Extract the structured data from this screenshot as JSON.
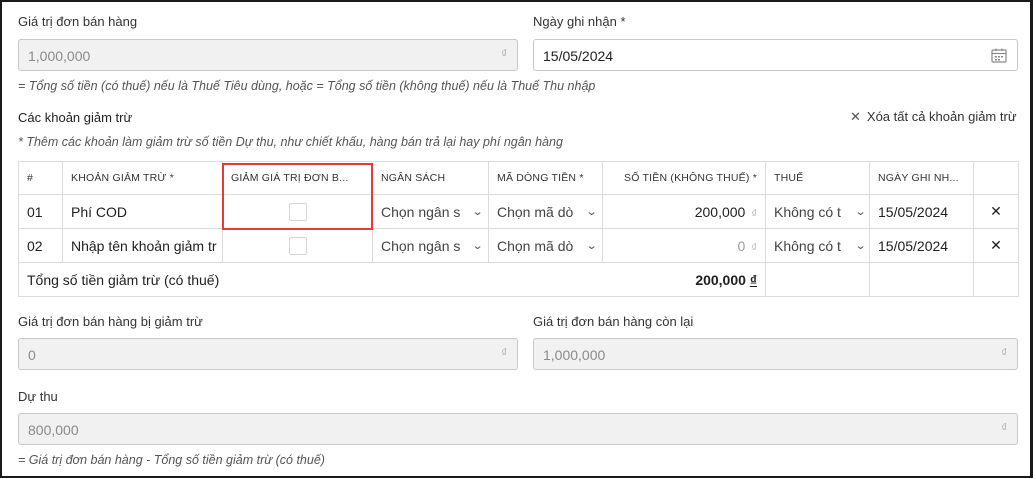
{
  "top": {
    "order_value_label": "Giá trị đơn bán hàng",
    "order_value": "1,000,000",
    "currency_symbol": "₫",
    "record_date_label": "Ngày ghi nhận *",
    "record_date": "15/05/2024",
    "note": "= Tổng số tiền (có thuế) nếu là Thuế Tiêu dùng, hoặc = Tổng số tiền (không thuế) nếu là Thuế Thu nhập"
  },
  "deductions": {
    "title": "Các khoản giảm trừ",
    "clear_all_icon": "close-icon",
    "clear_all": "Xóa tất cả khoản giảm trừ",
    "hint": "* Thêm các khoản làm giảm trừ số tiền Dự thu, như chiết khấu, hàng bán trả lại hay phí ngân hàng",
    "columns": [
      "#",
      "KHOẢN GIẢM TRỪ *",
      "GIẢM GIÁ TRỊ ĐƠN B...",
      "NGÂN SÁCH",
      "MÃ DÒNG TIỀN *",
      "SỐ TIỀN (KHÔNG THUẾ) *",
      "THUẾ",
      "NGÀY GHI NH..."
    ],
    "rows": [
      {
        "index": "01",
        "name": "Phí COD",
        "budget": "Chọn ngân s",
        "cashflow": "Chọn mã dò",
        "amount": "200,000",
        "currency": "₫",
        "tax": "Không có t",
        "date": "15/05/2024"
      },
      {
        "index": "02",
        "name_placeholder": "Nhập tên khoản giảm tr",
        "budget": "Chọn ngân s",
        "cashflow": "Chọn mã dò",
        "amount": "0",
        "currency": "₫",
        "tax": "Không có t",
        "date": "15/05/2024"
      }
    ],
    "total_label": "Tổng số tiền giảm trừ (có thuế)",
    "total_value": "200,000",
    "total_currency": "₫"
  },
  "bottom": {
    "reduced_label": "Giá trị đơn bán hàng bị giảm trừ",
    "reduced_value": "0",
    "remaining_label": "Giá trị đơn bán hàng còn lại",
    "remaining_value": "1,000,000",
    "expected_label": "Dự thu",
    "expected_value": "800,000",
    "expected_note": "= Giá trị đơn bán hàng - Tổng số tiền giảm trừ (có thuế)"
  },
  "colors": {
    "highlight": "#e53935",
    "border": "#dcdcdc",
    "disabled_bg": "#f1f1f1"
  }
}
